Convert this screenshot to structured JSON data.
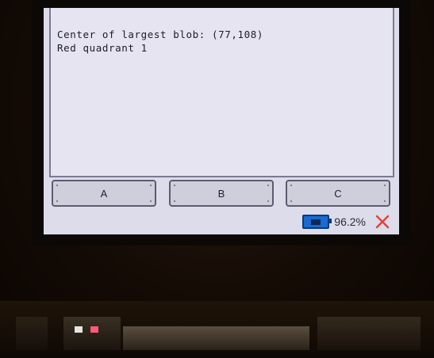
{
  "console": {
    "lines": [
      "Center of largest blob: (77,108)",
      "Red quadrant 1"
    ]
  },
  "buttons": [
    {
      "label": "A"
    },
    {
      "label": "B"
    },
    {
      "label": "C"
    }
  ],
  "status": {
    "battery_percent": "96.2%",
    "battery_icon": "battery-icon",
    "close_icon": "close-icon",
    "close_color": "#e0443c"
  }
}
